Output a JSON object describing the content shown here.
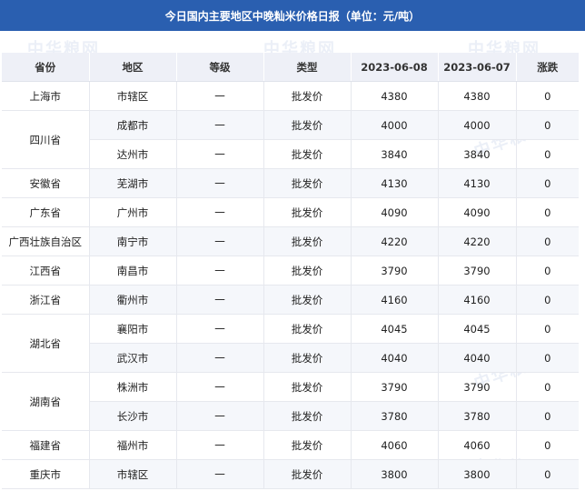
{
  "title": "今日国内主要地区中晚籼米价格日报（单位：元/吨）",
  "watermark": "中华粮网",
  "headers": [
    "省份",
    "地区",
    "等级",
    "类型",
    "2023-06-08",
    "2023-06-07",
    "涨跌"
  ],
  "groups": [
    {
      "province": "上海市",
      "rows": [
        [
          "市辖区",
          "一",
          "批发价",
          "4380",
          "4380",
          "0"
        ]
      ]
    },
    {
      "province": "四川省",
      "rows": [
        [
          "成都市",
          "一",
          "批发价",
          "4000",
          "4000",
          "0"
        ],
        [
          "达州市",
          "一",
          "批发价",
          "3840",
          "3840",
          "0"
        ]
      ]
    },
    {
      "province": "安徽省",
      "rows": [
        [
          "芜湖市",
          "一",
          "批发价",
          "4130",
          "4130",
          "0"
        ]
      ]
    },
    {
      "province": "广东省",
      "rows": [
        [
          "广州市",
          "一",
          "批发价",
          "4090",
          "4090",
          "0"
        ]
      ]
    },
    {
      "province": "广西壮族自治区",
      "rows": [
        [
          "南宁市",
          "一",
          "批发价",
          "4220",
          "4220",
          "0"
        ]
      ]
    },
    {
      "province": "江西省",
      "rows": [
        [
          "南昌市",
          "一",
          "批发价",
          "3790",
          "3790",
          "0"
        ]
      ]
    },
    {
      "province": "浙江省",
      "rows": [
        [
          "衢州市",
          "一",
          "批发价",
          "4160",
          "4160",
          "0"
        ]
      ]
    },
    {
      "province": "湖北省",
      "rows": [
        [
          "襄阳市",
          "一",
          "批发价",
          "4045",
          "4045",
          "0"
        ],
        [
          "武汉市",
          "一",
          "批发价",
          "4040",
          "4040",
          "0"
        ]
      ]
    },
    {
      "province": "湖南省",
      "rows": [
        [
          "株洲市",
          "一",
          "批发价",
          "3790",
          "3790",
          "0"
        ],
        [
          "长沙市",
          "一",
          "批发价",
          "3780",
          "3780",
          "0"
        ]
      ]
    },
    {
      "province": "福建省",
      "rows": [
        [
          "福州市",
          "一",
          "批发价",
          "4060",
          "4060",
          "0"
        ]
      ]
    },
    {
      "province": "重庆市",
      "rows": [
        [
          "市辖区",
          "一",
          "批发价",
          "3800",
          "3800",
          "0"
        ]
      ]
    }
  ]
}
